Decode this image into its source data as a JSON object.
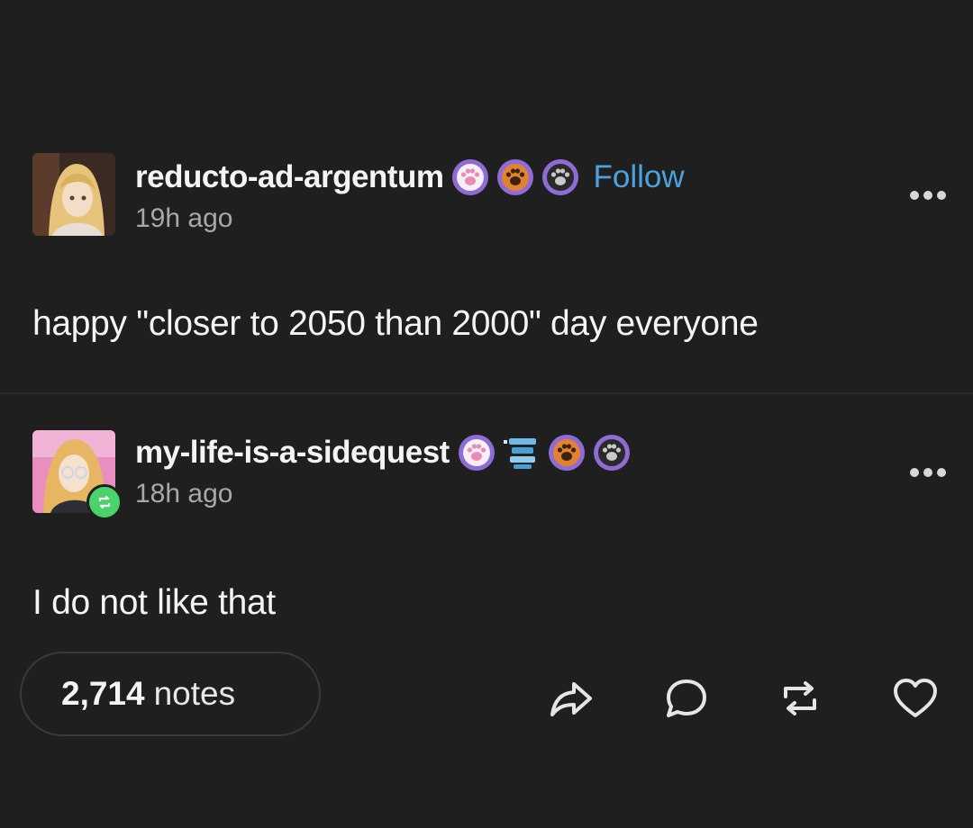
{
  "posts": [
    {
      "username": "reducto-ad-argentum",
      "badges": [
        "pink-paw-badge-icon",
        "orange-paw-badge-icon",
        "grey-paw-badge-icon"
      ],
      "follow_label": "Follow",
      "timestamp": "19h ago",
      "text": "happy \"closer to 2050 than 2000\" day everyone"
    },
    {
      "username": "my-life-is-a-sidequest",
      "badges": [
        "pink-paw-badge-icon",
        "blue-stack-badge-icon",
        "orange-paw-badge-icon",
        "grey-paw-badge-icon"
      ],
      "timestamp": "18h ago",
      "text": "I do not like that"
    }
  ],
  "footer": {
    "notes_count": "2,714",
    "notes_label": "notes",
    "actions": [
      "share-icon",
      "reply-icon",
      "reblog-icon",
      "like-icon"
    ]
  },
  "colors": {
    "background": "#1f1f1f",
    "accent_link": "#4aa3df",
    "reblog_badge": "#4bd36b",
    "badge_purple": "#8f6bd6",
    "badge_orange": "#e3822e"
  }
}
